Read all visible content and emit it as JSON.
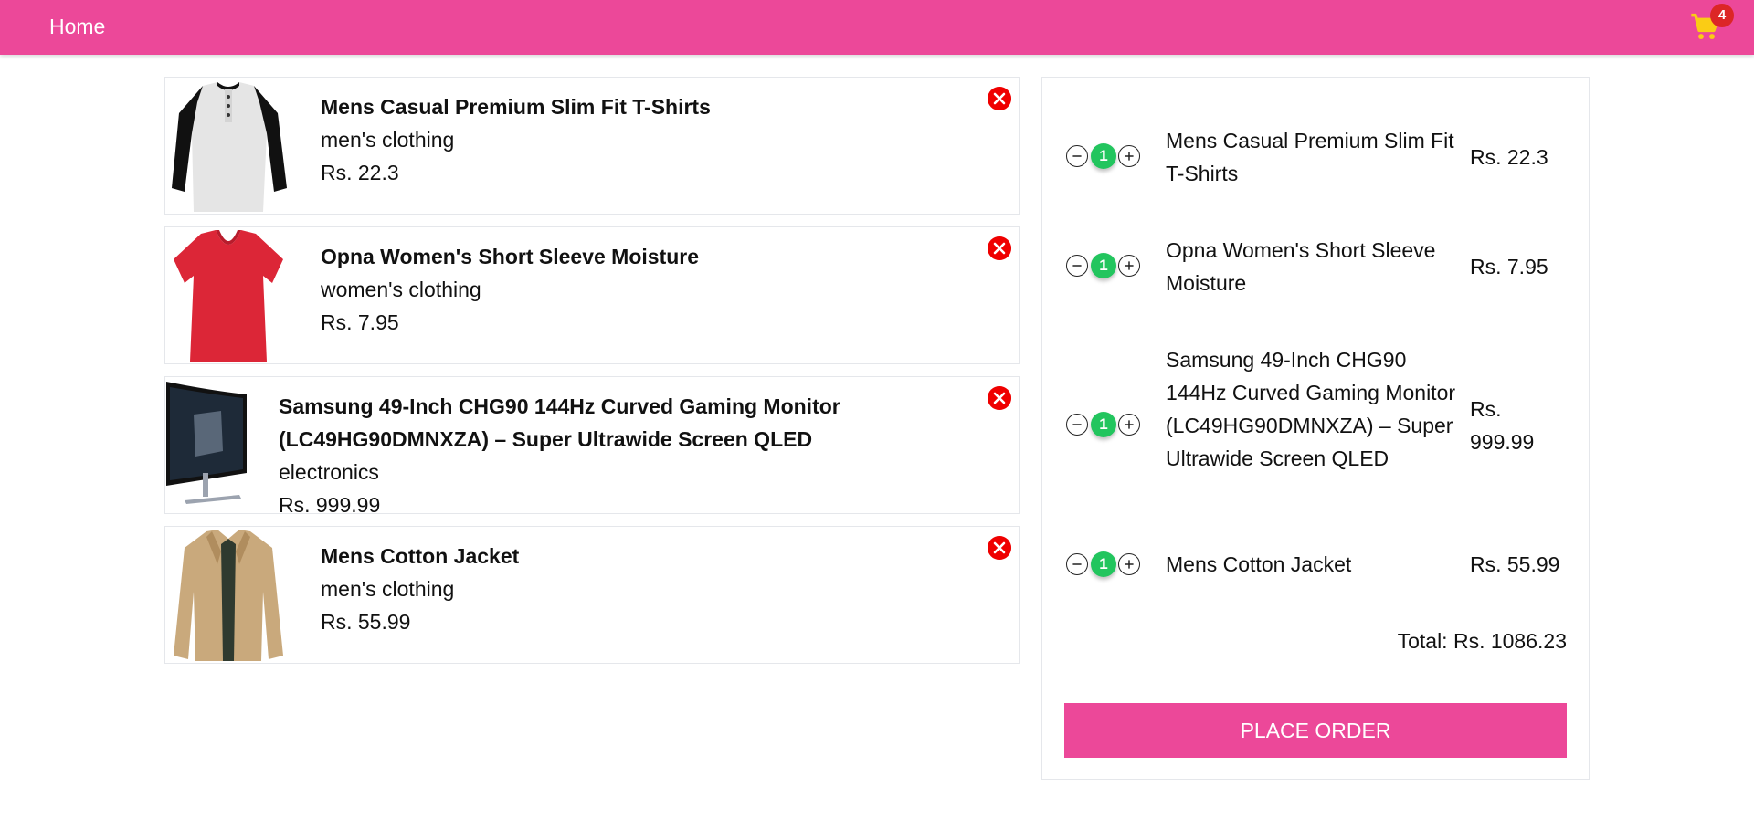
{
  "nav": {
    "home_label": "Home",
    "cart_count": "4"
  },
  "colors": {
    "accent": "#ec4899",
    "remove": "#ef0000",
    "qty": "#22c55e",
    "badge": "#dc2626"
  },
  "cart_items": [
    {
      "title": "Mens Casual Premium Slim Fit T-Shirts",
      "category": "men's clothing",
      "price": "Rs. 22.3",
      "image": "tshirt-image"
    },
    {
      "title": "Opna Women's Short Sleeve Moisture",
      "category": "women's clothing",
      "price": "Rs. 7.95",
      "image": "red-shirt-image"
    },
    {
      "title": "Samsung 49-Inch CHG90 144Hz Curved Gaming Monitor (LC49HG90DMNXZA) – Super Ultrawide Screen QLED",
      "category": "electronics",
      "price": "Rs. 999.99",
      "image": "monitor-image"
    },
    {
      "title": "Mens Cotton Jacket",
      "category": "men's clothing",
      "price": "Rs. 55.99",
      "image": "jacket-image"
    }
  ],
  "summary": {
    "rows": [
      {
        "qty": "1",
        "name": "Mens Casual Premium Slim Fit T-Shirts",
        "price": "Rs. 22.3"
      },
      {
        "qty": "1",
        "name": "Opna Women's Short Sleeve Moisture",
        "price": "Rs. 7.95"
      },
      {
        "qty": "1",
        "name": "Samsung 49-Inch CHG90 144Hz Curved Gaming Monitor (LC49HG90DMNXZA) – Super Ultrawide Screen QLED",
        "price": "Rs. 999.99"
      },
      {
        "qty": "1",
        "name": "Mens Cotton Jacket",
        "price": "Rs. 55.99"
      }
    ],
    "total": "Total: Rs. 1086.23",
    "place_order_label": "PLACE ORDER"
  }
}
